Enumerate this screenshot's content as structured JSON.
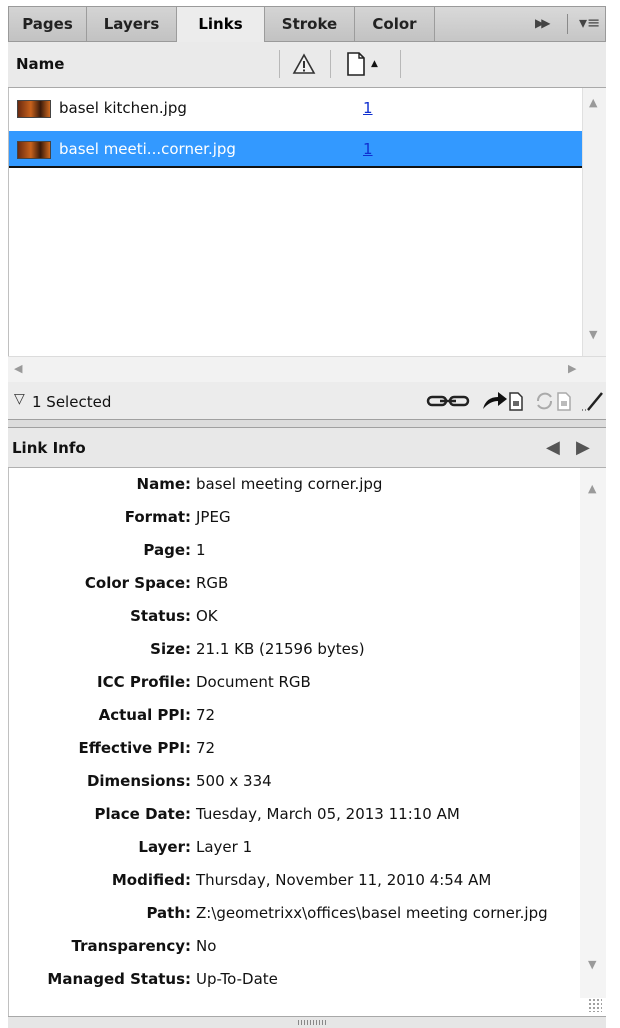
{
  "tabs": [
    {
      "label": "Pages"
    },
    {
      "label": "Layers"
    },
    {
      "label": "Links"
    },
    {
      "label": "Stroke"
    },
    {
      "label": "Color"
    }
  ],
  "columns": {
    "name": "Name"
  },
  "links": [
    {
      "name": "basel kitchen.jpg",
      "page": "1"
    },
    {
      "name": "basel meeti...corner.jpg",
      "page": "1"
    }
  ],
  "status": {
    "selected": "1 Selected"
  },
  "link_info": {
    "title": "Link Info",
    "rows": [
      {
        "label": "Name:",
        "value": "basel meeting corner.jpg"
      },
      {
        "label": "Format:",
        "value": "JPEG"
      },
      {
        "label": "Page:",
        "value": "1"
      },
      {
        "label": "Color Space:",
        "value": "RGB"
      },
      {
        "label": "Status:",
        "value": "OK"
      },
      {
        "label": "Size:",
        "value": "21.1 KB (21596 bytes)"
      },
      {
        "label": "ICC Profile:",
        "value": "Document RGB"
      },
      {
        "label": "Actual PPI:",
        "value": "72"
      },
      {
        "label": "Effective PPI:",
        "value": "72"
      },
      {
        "label": "Dimensions:",
        "value": "500 x 334"
      },
      {
        "label": "Place Date:",
        "value": "Tuesday, March 05, 2013 11:10 AM"
      },
      {
        "label": "Layer:",
        "value": "Layer 1"
      },
      {
        "label": "Modified:",
        "value": "Thursday, November 11, 2010 4:54 AM"
      },
      {
        "label": "Path:",
        "value": "Z:\\geometrixx\\offices\\basel meeting corner.jpg"
      },
      {
        "label": "Transparency:",
        "value": "No"
      },
      {
        "label": "Managed Status:",
        "value": "Up-To-Date"
      }
    ]
  },
  "colors": {
    "selection": "#3399ff",
    "page_link": "#1030d0"
  }
}
